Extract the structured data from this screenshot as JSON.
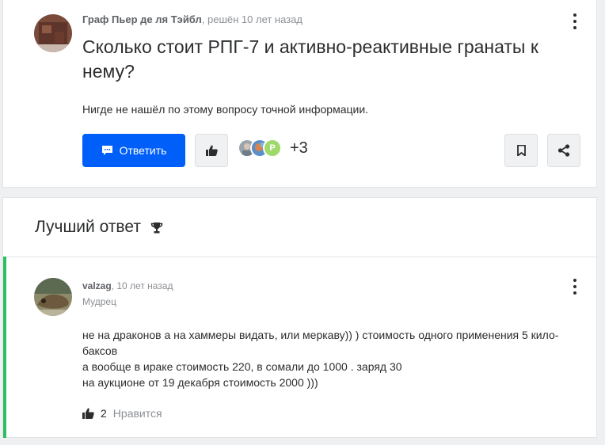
{
  "question": {
    "author": "Граф Пьер де ля Тэйбл",
    "meta": ", решён 10 лет назад",
    "title": "Сколько стоит РПГ-7 и активно-реактивные гранаты к нему?",
    "text": "Нигде не нашёл по этому вопросу точной информации.",
    "reply_label": "Ответить",
    "participant_initial": "P",
    "more_participants": "+3",
    "icons": [
      "more-icon",
      "reply-icon",
      "thumbs-up-icon",
      "bookmark-icon",
      "share-icon"
    ]
  },
  "best_answer": {
    "heading": "Лучший ответ",
    "author": "valzag",
    "meta": ", 10 лет назад",
    "rank": "Мудрец",
    "lines": [
      "не на драконов а на хаммеры видать, или меркаву)) ) стоимость одного применения 5 кило­баксов",
      "а вообще в ираке стоимость 220, в сомали до 1000 . заряд 30",
      "на аукционе от 19 декабря стоимость 2000 )))"
    ],
    "likes": "2",
    "like_label": "Нравится",
    "icons": [
      "trophy-icon",
      "more-icon",
      "thumbs-up-icon"
    ]
  },
  "colors": {
    "accent": "#005ff9",
    "best_answer_bar": "#2dbe64",
    "background": "#eff0f1"
  }
}
